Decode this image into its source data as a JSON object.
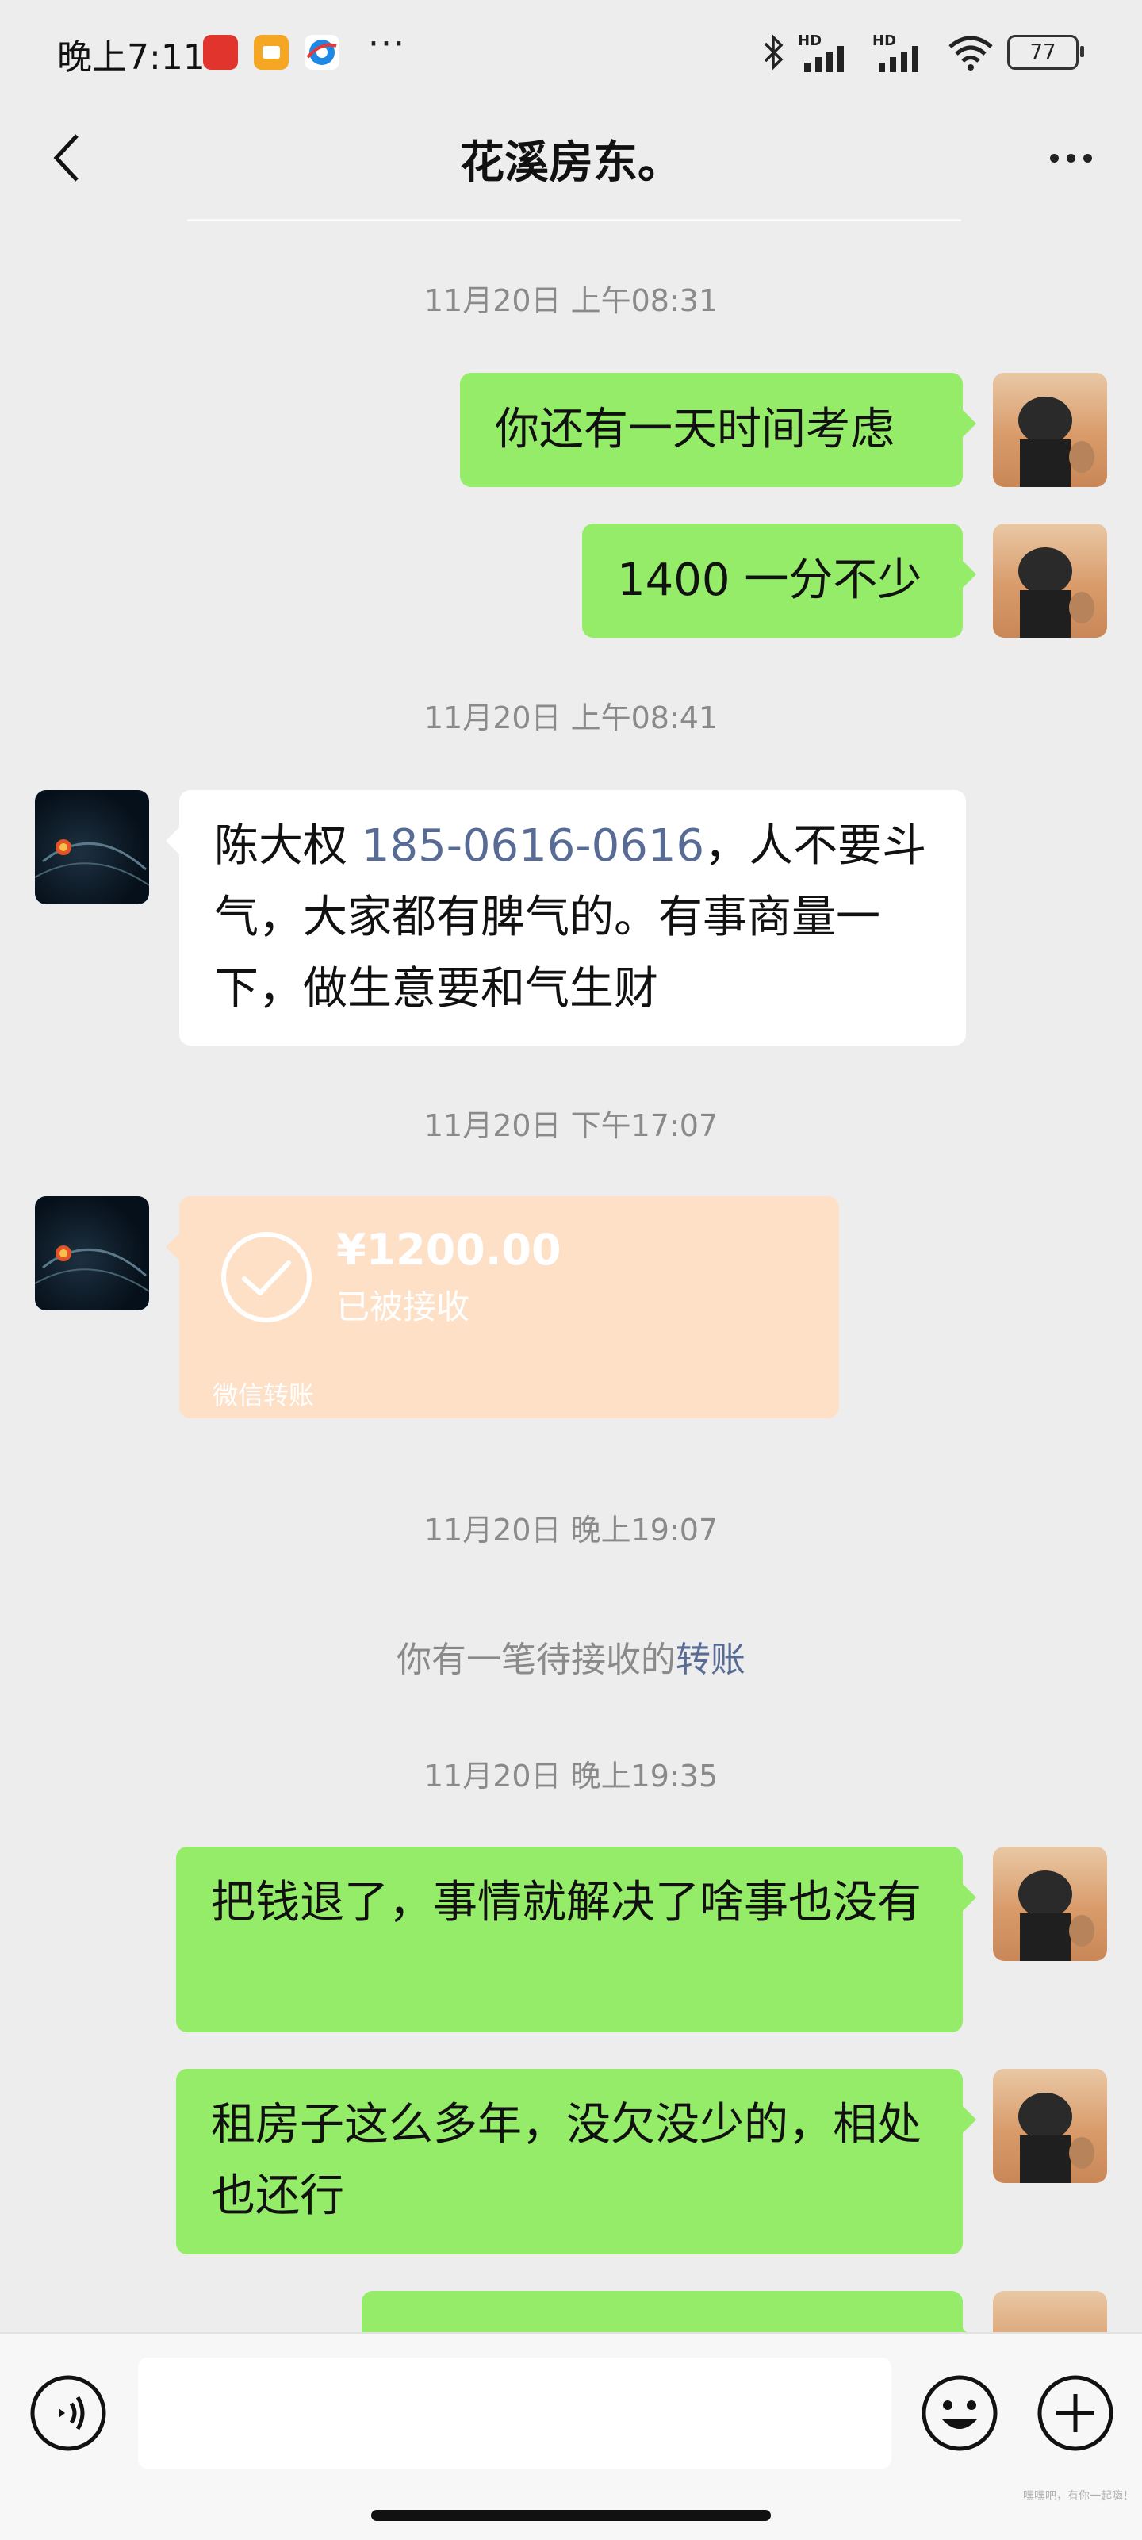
{
  "status_bar": {
    "time": "晚上7:11",
    "more": "···",
    "signal_labels": [
      "HD",
      "HD"
    ],
    "battery": "77",
    "icons": [
      "app-icon-red",
      "app-icon-orange",
      "app-icon-browser",
      "bluetooth-icon",
      "signal-icon",
      "wifi-icon",
      "battery-icon"
    ]
  },
  "nav": {
    "title": "花溪房东。",
    "back_icon": "chevron-left-icon",
    "more_icon": "more-dots-icon"
  },
  "chat": {
    "timestamps": [
      "11月20日 上午08:31",
      "11月20日 上午08:41",
      "11月20日 下午17:07",
      "11月20日 晚上19:07",
      "11月20日 晚上19:35"
    ],
    "messages": [
      {
        "from": "me",
        "text": "你还有一天时间考虑"
      },
      {
        "from": "me",
        "text": "1400 一分不少"
      },
      {
        "from": "them",
        "text_before": "陈大权 ",
        "link": "185-0616-0616",
        "text_after": "，人不要斗气，大家都有脾气的。有事商量一下，做生意要和气生财"
      },
      {
        "from": "me",
        "text": "把钱退了，事情就解决了啥事也没有"
      },
      {
        "from": "me",
        "text": "租房子这么多年，没欠没少的，相处也还行"
      }
    ],
    "transfer": {
      "amount": "¥1200.00",
      "status": "已被接收",
      "footer": "微信转账"
    },
    "system_notice": {
      "text": "你有一笔待接收的",
      "link": "转账"
    }
  },
  "input_bar": {
    "voice_icon": "voice-icon",
    "emoji_icon": "emoji-icon",
    "plus_icon": "plus-icon",
    "value": ""
  },
  "watermark": "嘿嘿吧，有你一起嗨！"
}
